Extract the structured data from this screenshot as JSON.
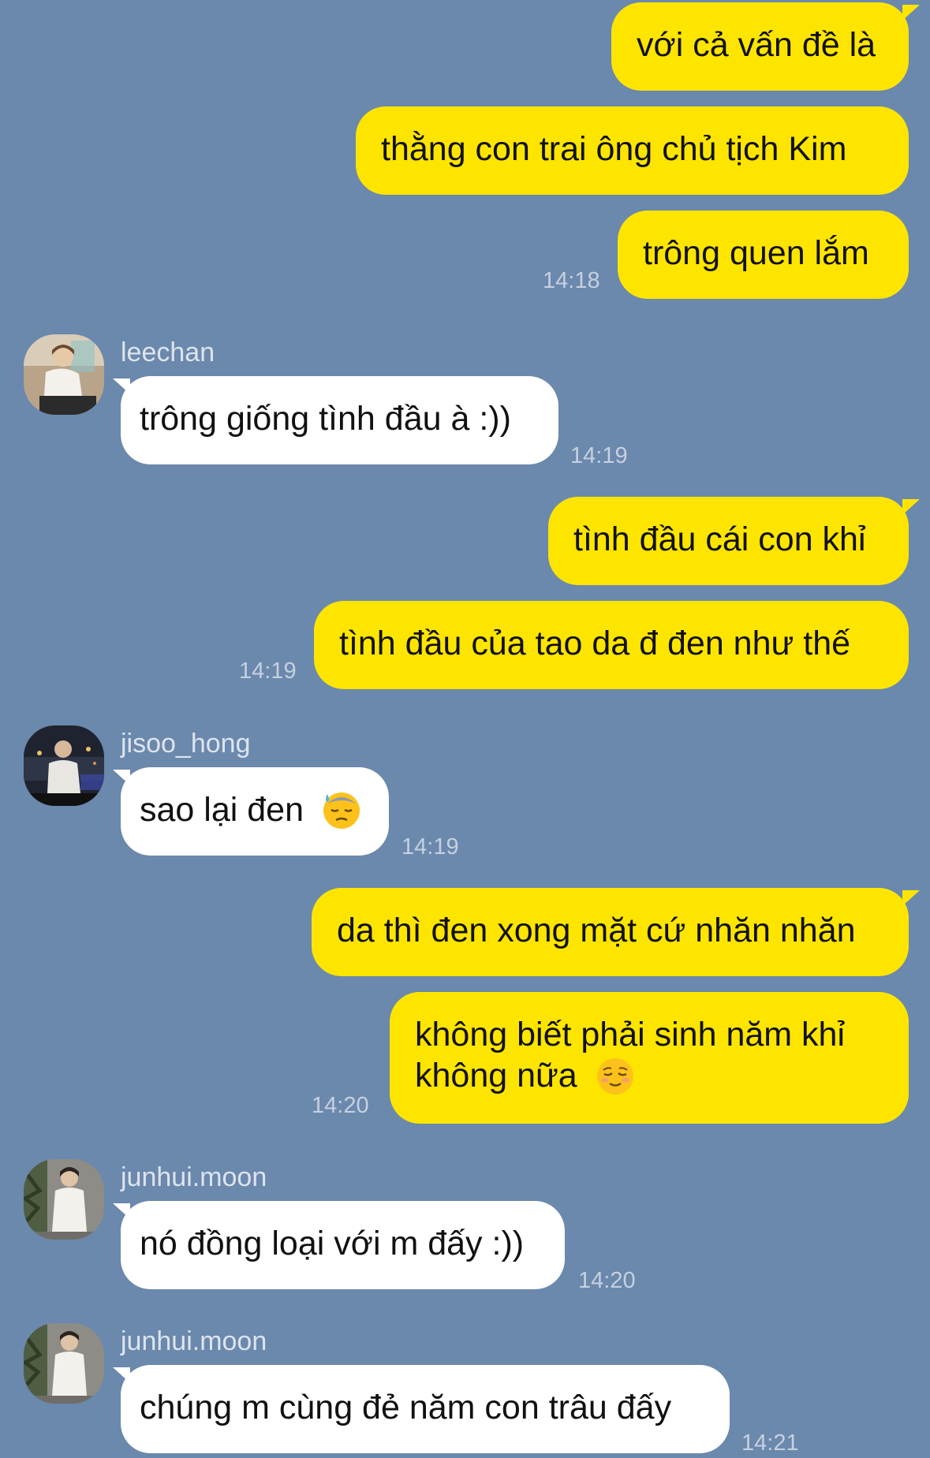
{
  "messages": [
    {
      "text": "với cả vấn đề là"
    },
    {
      "text": "thằng con trai ông chủ tịch Kim"
    },
    {
      "text": "trông quen lắm",
      "time": "14:18"
    },
    {
      "sender": "leechan",
      "text": "trông giống tình đầu à :))",
      "time": "14:19"
    },
    {
      "text": "tình đầu cái con khỉ"
    },
    {
      "text": "tình đầu của tao da đ đen như thế",
      "time": "14:19"
    },
    {
      "sender": "jisoo_hong",
      "text": "sao lại đen",
      "emoji": "downcast-sweat-face-emoji",
      "time": "14:19"
    },
    {
      "text": "da thì đen xong mặt cứ nhăn nhăn"
    },
    {
      "line1": "không biết phải sinh năm khỉ",
      "line2": "không nữa",
      "emoji": "relieved-face-emoji",
      "time": "14:20"
    },
    {
      "sender": "junhui.moon",
      "text": "nó đồng loại với m đấy :))",
      "time": "14:20"
    },
    {
      "sender": "junhui.moon",
      "text": "chúng m cùng đẻ năm con trâu đấy",
      "time": "14:21"
    }
  ],
  "colors": {
    "background": "#6b88ad",
    "my_bubble": "#fee500",
    "their_bubble": "#ffffff"
  }
}
